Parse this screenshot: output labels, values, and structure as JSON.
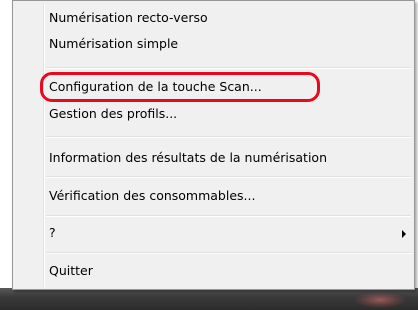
{
  "menu": {
    "items": [
      {
        "label": "Numérisation recto-verso"
      },
      {
        "label": "Numérisation simple"
      },
      {
        "label": "Configuration de la touche Scan..."
      },
      {
        "label": "Gestion des profils..."
      },
      {
        "label": "Information des résultats de la numérisation"
      },
      {
        "label": "Vérification des consommables..."
      },
      {
        "label": "?"
      },
      {
        "label": "Quitter"
      }
    ]
  },
  "annotation": {
    "highlight_color": "#e8091c",
    "highlighted_item": "Configuration de la touche Scan..."
  },
  "icons": {
    "submenu_arrow": "chevron-right-icon"
  }
}
